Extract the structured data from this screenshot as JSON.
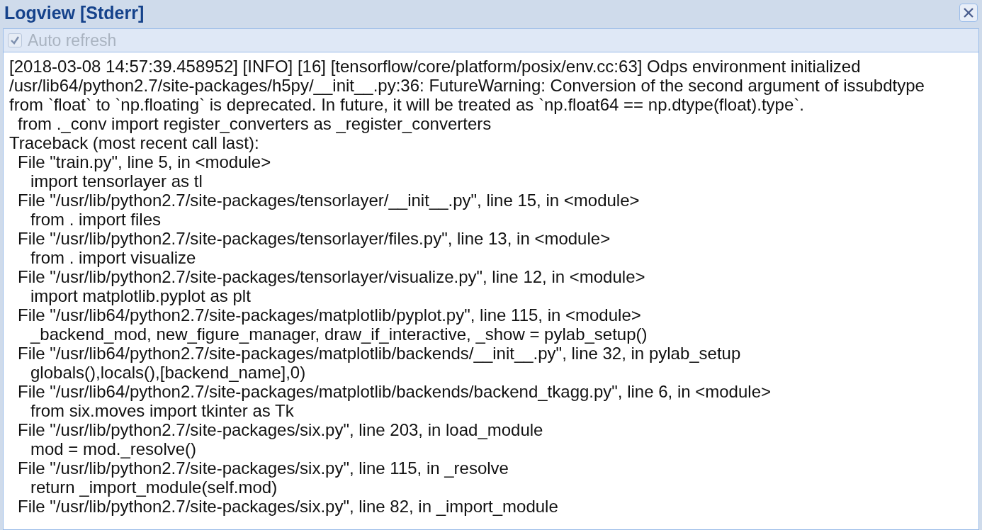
{
  "window": {
    "title": "Logview [Stderr]"
  },
  "toolbar": {
    "auto_refresh": {
      "label": "Auto refresh",
      "checked": true,
      "disabled": true
    }
  },
  "log": [
    {
      "kind": "text",
      "text": "[2018-03-08 14:57:39.458952] [INFO] [16] [tensorflow/core/platform/posix/env.cc:63] Odps environment initialized"
    },
    {
      "kind": "text",
      "text": "/usr/lib64/python2.7/site-packages/h5py/__init__.py:36: FutureWarning: Conversion of the second argument of issubdtype"
    },
    {
      "kind": "text",
      "text": "from `float` to `np.floating` is deprecated. In future, it will be treated as `np.float64 == np.dtype(float).type`."
    },
    {
      "kind": "frame",
      "text": "from ._conv import register_converters as _register_converters"
    },
    {
      "kind": "text",
      "text": "Traceback (most recent call last):"
    },
    {
      "kind": "frame",
      "text": "File \"train.py\", line 5, in <module>"
    },
    {
      "kind": "code",
      "text": "import tensorlayer as tl"
    },
    {
      "kind": "frame",
      "text": "File \"/usr/lib/python2.7/site-packages/tensorlayer/__init__.py\", line 15, in <module>"
    },
    {
      "kind": "code",
      "text": "from . import files"
    },
    {
      "kind": "frame",
      "text": "File \"/usr/lib/python2.7/site-packages/tensorlayer/files.py\", line 13, in <module>"
    },
    {
      "kind": "code",
      "text": "from . import visualize"
    },
    {
      "kind": "frame",
      "text": "File \"/usr/lib/python2.7/site-packages/tensorlayer/visualize.py\", line 12, in <module>"
    },
    {
      "kind": "code",
      "text": "import matplotlib.pyplot as plt"
    },
    {
      "kind": "frame",
      "text": "File \"/usr/lib64/python2.7/site-packages/matplotlib/pyplot.py\", line 115, in <module>"
    },
    {
      "kind": "code",
      "text": "_backend_mod, new_figure_manager, draw_if_interactive, _show = pylab_setup()"
    },
    {
      "kind": "frame",
      "text": "File \"/usr/lib64/python2.7/site-packages/matplotlib/backends/__init__.py\", line 32, in pylab_setup"
    },
    {
      "kind": "code",
      "text": "globals(),locals(),[backend_name],0)"
    },
    {
      "kind": "frame",
      "text": "File \"/usr/lib64/python2.7/site-packages/matplotlib/backends/backend_tkagg.py\", line 6, in <module>"
    },
    {
      "kind": "code",
      "text": "from six.moves import tkinter as Tk"
    },
    {
      "kind": "frame",
      "text": "File \"/usr/lib/python2.7/site-packages/six.py\", line 203, in load_module"
    },
    {
      "kind": "code",
      "text": "mod = mod._resolve()"
    },
    {
      "kind": "frame",
      "text": "File \"/usr/lib/python2.7/site-packages/six.py\", line 115, in _resolve"
    },
    {
      "kind": "code",
      "text": "return _import_module(self.mod)"
    },
    {
      "kind": "frame",
      "text": "File \"/usr/lib/python2.7/site-packages/six.py\", line 82, in _import_module"
    }
  ]
}
